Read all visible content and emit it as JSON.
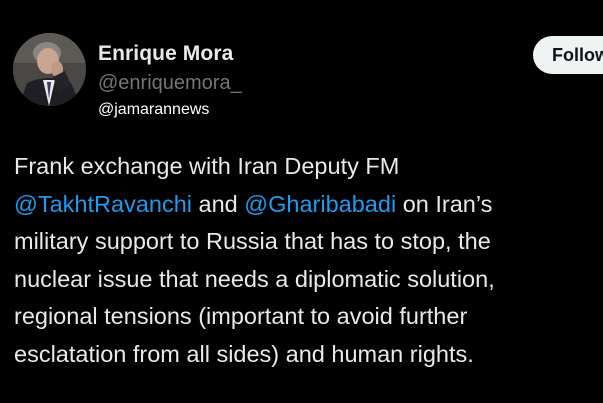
{
  "author": {
    "display_name": "Enrique Mora",
    "handle": "@enriquemora_",
    "avatar_icon": "profile-photo-man-in-suit"
  },
  "watermark": "@jamarannews",
  "follow_button": {
    "label": "Follow"
  },
  "tweet": {
    "line1": "Frank exchange with Iran Deputy FM",
    "mention1": "@TakhtRavanchi",
    "line2_mid": " and ",
    "mention2": "@Gharibabadi",
    "line2_end": " on Iran’s",
    "line3": "military support to Russia that has to stop, the",
    "line4": "nuclear issue that needs a diplomatic solution,",
    "line5": "regional tensions (important to avoid further",
    "line6": "esclatation from all sides) and human rights."
  },
  "colors": {
    "background": "#000000",
    "text": "#e7e9ea",
    "secondary_text": "#71767b",
    "mention": "#1d9bf0",
    "button_bg": "#eff3f4"
  }
}
